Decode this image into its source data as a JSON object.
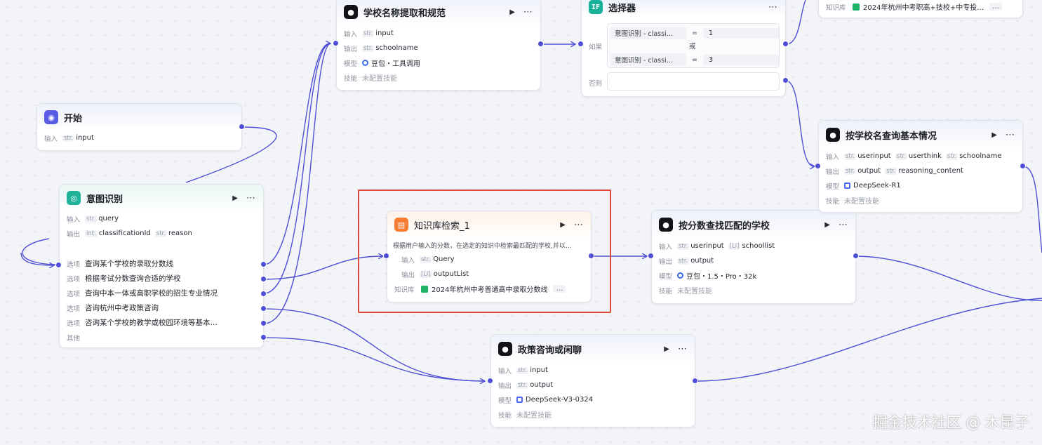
{
  "colors": {
    "edge": "#4e4fd6",
    "highlight": "#e0483b"
  },
  "labels": {
    "input": "输入",
    "output": "输出",
    "model": "模型",
    "skill": "技能",
    "option": "选项",
    "other": "其他",
    "kb": "知识库",
    "if": "如果",
    "else": "否则",
    "or": "或"
  },
  "nodes": {
    "start": {
      "title": "开始",
      "icon": "start-icon",
      "inputs": [
        {
          "type": "str.",
          "name": "input"
        }
      ]
    },
    "intent": {
      "title": "意图识别",
      "icon": "intent-icon",
      "inputs": [
        {
          "type": "str.",
          "name": "query"
        }
      ],
      "outputs": [
        {
          "type": "int.",
          "name": "classificationId"
        },
        {
          "type": "str.",
          "name": "reason"
        }
      ],
      "options": [
        "查询某个学校的录取分数线",
        "根据考试分数查询合适的学校",
        "查询中本一体或高职学校的招生专业情况",
        "咨询杭州中考政策咨询",
        "咨询某个学校的教学或校园环境等基本…"
      ]
    },
    "extract": {
      "title": "学校名称提取和规范",
      "icon": "llm-icon",
      "inputs": [
        {
          "type": "str.",
          "name": "input"
        }
      ],
      "outputs": [
        {
          "type": "str.",
          "name": "schoolname"
        }
      ],
      "model": "豆包・工具调用",
      "skill": "未配置技能"
    },
    "selector": {
      "title": "选择器",
      "icon": "if-icon",
      "if_icon_text": "IF",
      "conditions": [
        {
          "left": "意图识别 - classi…",
          "op": "=",
          "right": "1"
        },
        {
          "left": "意图识别 - classi…",
          "op": "=",
          "right": "3"
        }
      ]
    },
    "kb": {
      "title": "知识库检索_1",
      "icon": "kb-icon",
      "desc": "根据用户输入的分数，在选定的知识中检索最匹配的学校,并以…",
      "inputs": [
        {
          "type": "str.",
          "name": "Query"
        }
      ],
      "outputs": [
        {
          "type": "[Ll]",
          "name": "outputList"
        }
      ],
      "kb_name": "2024年杭州中考普通高中录取分数线",
      "more": "…"
    },
    "score": {
      "title": "按分数查找匹配的学校",
      "icon": "llm-icon",
      "inputs": [
        {
          "type": "str.",
          "name": "userinput"
        },
        {
          "type": "[Ll]",
          "name": "schoollist"
        }
      ],
      "outputs": [
        {
          "type": "str.",
          "name": "output"
        }
      ],
      "model": "豆包・1.5・Pro・32k",
      "skill": "未配置技能"
    },
    "policy": {
      "title": "政策咨询或闲聊",
      "icon": "llm-icon",
      "inputs": [
        {
          "type": "str.",
          "name": "input"
        }
      ],
      "outputs": [
        {
          "type": "str.",
          "name": "output"
        }
      ],
      "model": "DeepSeek-V3-0324",
      "skill": "未配置技能"
    },
    "basic": {
      "title": "按学校名查询基本情况",
      "icon": "llm-icon",
      "inputs": [
        {
          "type": "str.",
          "name": "userinput"
        },
        {
          "type": "str.",
          "name": "userthink"
        },
        {
          "type": "str.",
          "name": "schoolname"
        }
      ],
      "outputs": [
        {
          "type": "str.",
          "name": "output"
        },
        {
          "type": "str.",
          "name": "reasoning_content"
        }
      ],
      "model": "DeepSeek-R1",
      "skill": "未配置技能"
    },
    "topright": {
      "kb_name": "2024年杭州中考职高+技校+中专投…",
      "more": "…"
    }
  },
  "watermark": "掘金技术社区 @ 木昆子"
}
